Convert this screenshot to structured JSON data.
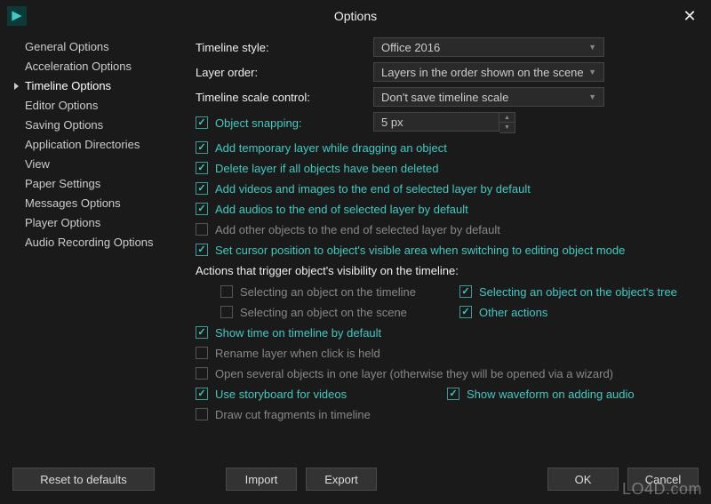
{
  "window": {
    "title": "Options",
    "close": "✕"
  },
  "sidebar": {
    "items": [
      "General Options",
      "Acceleration Options",
      "Timeline Options",
      "Editor Options",
      "Saving Options",
      "Application Directories",
      "View",
      "Paper Settings",
      "Messages Options",
      "Player Options",
      "Audio Recording Options"
    ],
    "selected_index": 2
  },
  "content": {
    "timeline_style": {
      "label": "Timeline style:",
      "value": "Office 2016"
    },
    "layer_order": {
      "label": "Layer order:",
      "value": "Layers in the order shown on the scene"
    },
    "scale_control": {
      "label": "Timeline scale control:",
      "value": "Don't save timeline scale"
    },
    "object_snapping": {
      "label": "Object snapping:",
      "checked": true,
      "value": "5 px"
    },
    "checks": {
      "add_temp_layer": {
        "label": "Add temporary layer while dragging an object",
        "checked": true
      },
      "delete_layer": {
        "label": "Delete layer if all objects have been deleted",
        "checked": true
      },
      "add_videos": {
        "label": "Add videos and images to the end of selected layer by default",
        "checked": true
      },
      "add_audios": {
        "label": "Add audios to the end of selected layer by default",
        "checked": true
      },
      "add_other": {
        "label": "Add other objects to the end of selected layer by default",
        "checked": false
      },
      "set_cursor": {
        "label": "Set cursor position to object's visible area when switching to editing object mode",
        "checked": true
      }
    },
    "visibility_header": "Actions that trigger object's visibility on the timeline:",
    "visibility": {
      "sel_timeline": {
        "label": "Selecting an object on the timeline",
        "checked": false
      },
      "sel_tree": {
        "label": "Selecting an object on the object's tree",
        "checked": true
      },
      "sel_scene": {
        "label": "Selecting an object on the scene",
        "checked": false
      },
      "other": {
        "label": "Other actions",
        "checked": true
      }
    },
    "checks2": {
      "show_time": {
        "label": "Show time on timeline by default",
        "checked": true
      },
      "rename_layer": {
        "label": "Rename layer when click is held",
        "checked": false
      },
      "open_several": {
        "label": "Open several objects in one layer (otherwise they will be opened via a wizard)",
        "checked": false
      },
      "use_storyboard": {
        "label": "Use storyboard for videos",
        "checked": true
      },
      "show_waveform": {
        "label": "Show waveform on adding audio",
        "checked": true
      },
      "draw_cut": {
        "label": "Draw cut fragments in timeline",
        "checked": false
      }
    }
  },
  "footer": {
    "reset": "Reset to defaults",
    "import": "Import",
    "export": "Export",
    "ok": "OK",
    "cancel": "Cancel"
  },
  "watermark": "LO4D.com"
}
